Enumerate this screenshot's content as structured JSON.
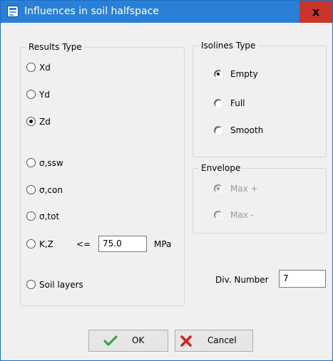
{
  "window": {
    "title": "Influences in soil halfspace",
    "close_symbol": "x"
  },
  "results_type": {
    "legend": "Results Type",
    "options": [
      {
        "label": "Xd",
        "checked": false
      },
      {
        "label": "Yd",
        "checked": false
      },
      {
        "label": "Zd",
        "checked": true
      },
      {
        "label": "σ,ssw",
        "checked": false
      },
      {
        "label": "σ,con",
        "checked": false
      },
      {
        "label": "σ,tot",
        "checked": false
      },
      {
        "label": "K,Z",
        "checked": false
      },
      {
        "label": "Soil layers",
        "checked": false
      }
    ],
    "kz_operator": "<=",
    "kz_value": "75.0",
    "kz_unit": "MPa"
  },
  "isolines_type": {
    "legend": "Isolines Type",
    "options": [
      {
        "label": "Empty",
        "checked": true
      },
      {
        "label": "Full",
        "checked": false
      },
      {
        "label": "Smooth",
        "checked": false
      }
    ]
  },
  "envelope": {
    "legend": "Envelope",
    "options": [
      {
        "label": "Max +",
        "checked": true,
        "disabled": true
      },
      {
        "label": "Max -",
        "checked": false,
        "disabled": true
      }
    ]
  },
  "div_number": {
    "label": "Div. Number",
    "value": "7"
  },
  "buttons": {
    "ok": {
      "label": "OK",
      "icon": "checkmark-icon",
      "icon_color": "#3aa53a"
    },
    "cancel": {
      "label": "Cancel",
      "icon": "cross-icon",
      "icon_color": "#d42020"
    }
  },
  "colors": {
    "titlebar": "#2a7fd6",
    "close_button": "#c9352b",
    "dialog_bg": "#f0f0f0"
  }
}
